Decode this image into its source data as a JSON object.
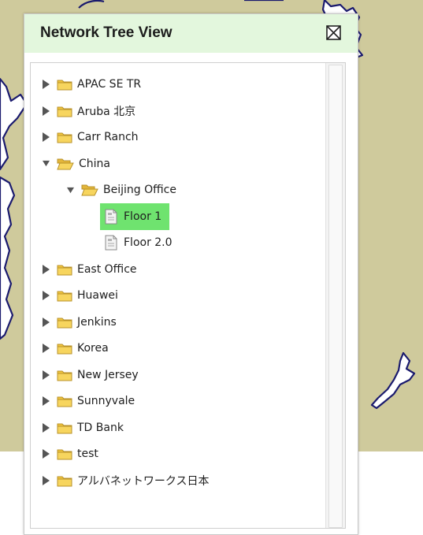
{
  "panel": {
    "title": "Network Tree View",
    "close_icon": "close-box-icon"
  },
  "tree": {
    "nodes": [
      {
        "label": "APAC SE TR",
        "type": "folder",
        "expanded": false,
        "level": 0
      },
      {
        "label": "Aruba 北京",
        "type": "folder",
        "expanded": false,
        "level": 0
      },
      {
        "label": "Carr Ranch",
        "type": "folder",
        "expanded": false,
        "level": 0
      },
      {
        "label": "China",
        "type": "folder",
        "expanded": true,
        "level": 0
      },
      {
        "label": "Beijing Office",
        "type": "folder",
        "expanded": true,
        "level": 1
      },
      {
        "label": "Floor 1",
        "type": "floor",
        "selected": true,
        "level": 2
      },
      {
        "label": "Floor 2.0",
        "type": "floor",
        "selected": false,
        "level": 2
      },
      {
        "label": "East Office",
        "type": "folder",
        "expanded": false,
        "level": 0
      },
      {
        "label": "Huawei",
        "type": "folder",
        "expanded": false,
        "level": 0
      },
      {
        "label": "Jenkins",
        "type": "folder",
        "expanded": false,
        "level": 0
      },
      {
        "label": "Korea",
        "type": "folder",
        "expanded": false,
        "level": 0
      },
      {
        "label": "New Jersey",
        "type": "folder",
        "expanded": false,
        "level": 0
      },
      {
        "label": "Sunnyvale",
        "type": "folder",
        "expanded": false,
        "level": 0
      },
      {
        "label": "TD Bank",
        "type": "folder",
        "expanded": false,
        "level": 0
      },
      {
        "label": "test",
        "type": "folder",
        "expanded": false,
        "level": 0
      },
      {
        "label": "アルバネットワークス日本",
        "type": "folder",
        "expanded": false,
        "level": 0
      }
    ]
  },
  "colors": {
    "header_bg": "#e3f7dd",
    "selected_bg": "#6fe36f",
    "map_land": "#cfca9c",
    "map_outline": "#1a1a6e",
    "folder": "#f2c53d"
  }
}
